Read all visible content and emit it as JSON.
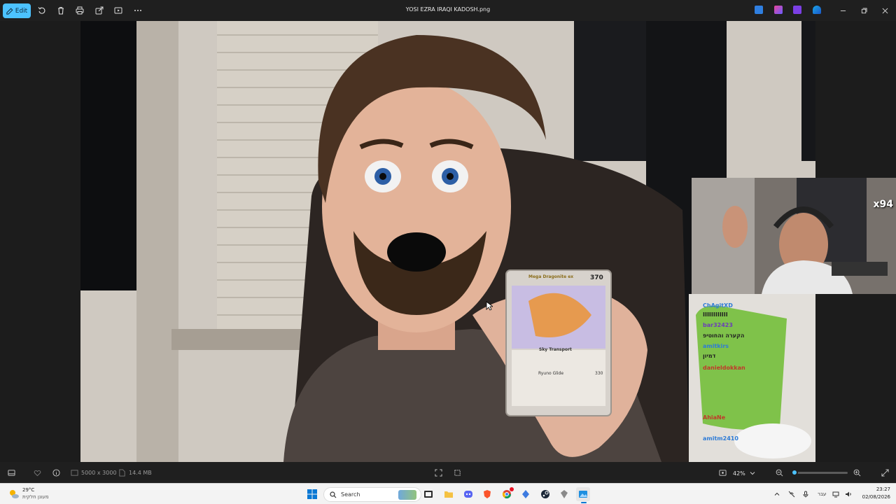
{
  "toolbar": {
    "edit_label": "Edit",
    "file_title": "YOSI EZRA IRAQI KADOSH.png",
    "icons": [
      "rotate-icon",
      "delete-icon",
      "print-icon",
      "share-icon",
      "slideshow-icon",
      "more-icon"
    ]
  },
  "photo": {
    "card_hp": "370",
    "card_name": "Mega Dragonite ex",
    "card_ability": "Sky Transport",
    "card_attack": "Ryuno Glide",
    "card_damage": "330",
    "overlay_counter": "x94",
    "chat": [
      {
        "text": "ChAgitXD",
        "color": "#2e7bd6"
      },
      {
        "text": "IIIIIIIIIIII",
        "color": "#222222"
      },
      {
        "text": "bar32423",
        "color": "#6b3fb8"
      },
      {
        "text": "הקערה והחוטיפ",
        "color": "#222222"
      },
      {
        "text": "amitkirs",
        "color": "#2e7bd6"
      },
      {
        "text": "דמיון",
        "color": "#222222"
      },
      {
        "text": "danieldokkan",
        "color": "#c0392b"
      },
      {
        "text": "AhiaNe",
        "color": "#c0392b"
      },
      {
        "text": "amitm2410",
        "color": "#2e7bd6"
      }
    ]
  },
  "infobar": {
    "dimensions": "5000 x 3000",
    "file_size": "14.4 MB",
    "zoom": "42%",
    "zoom_fraction": 0.05
  },
  "taskbar": {
    "weather_temp": "29°C",
    "weather_desc": "מעונן חלקית",
    "search_placeholder": "Search",
    "language": "עבר",
    "time": "23:27",
    "date": "02/08/2026"
  }
}
